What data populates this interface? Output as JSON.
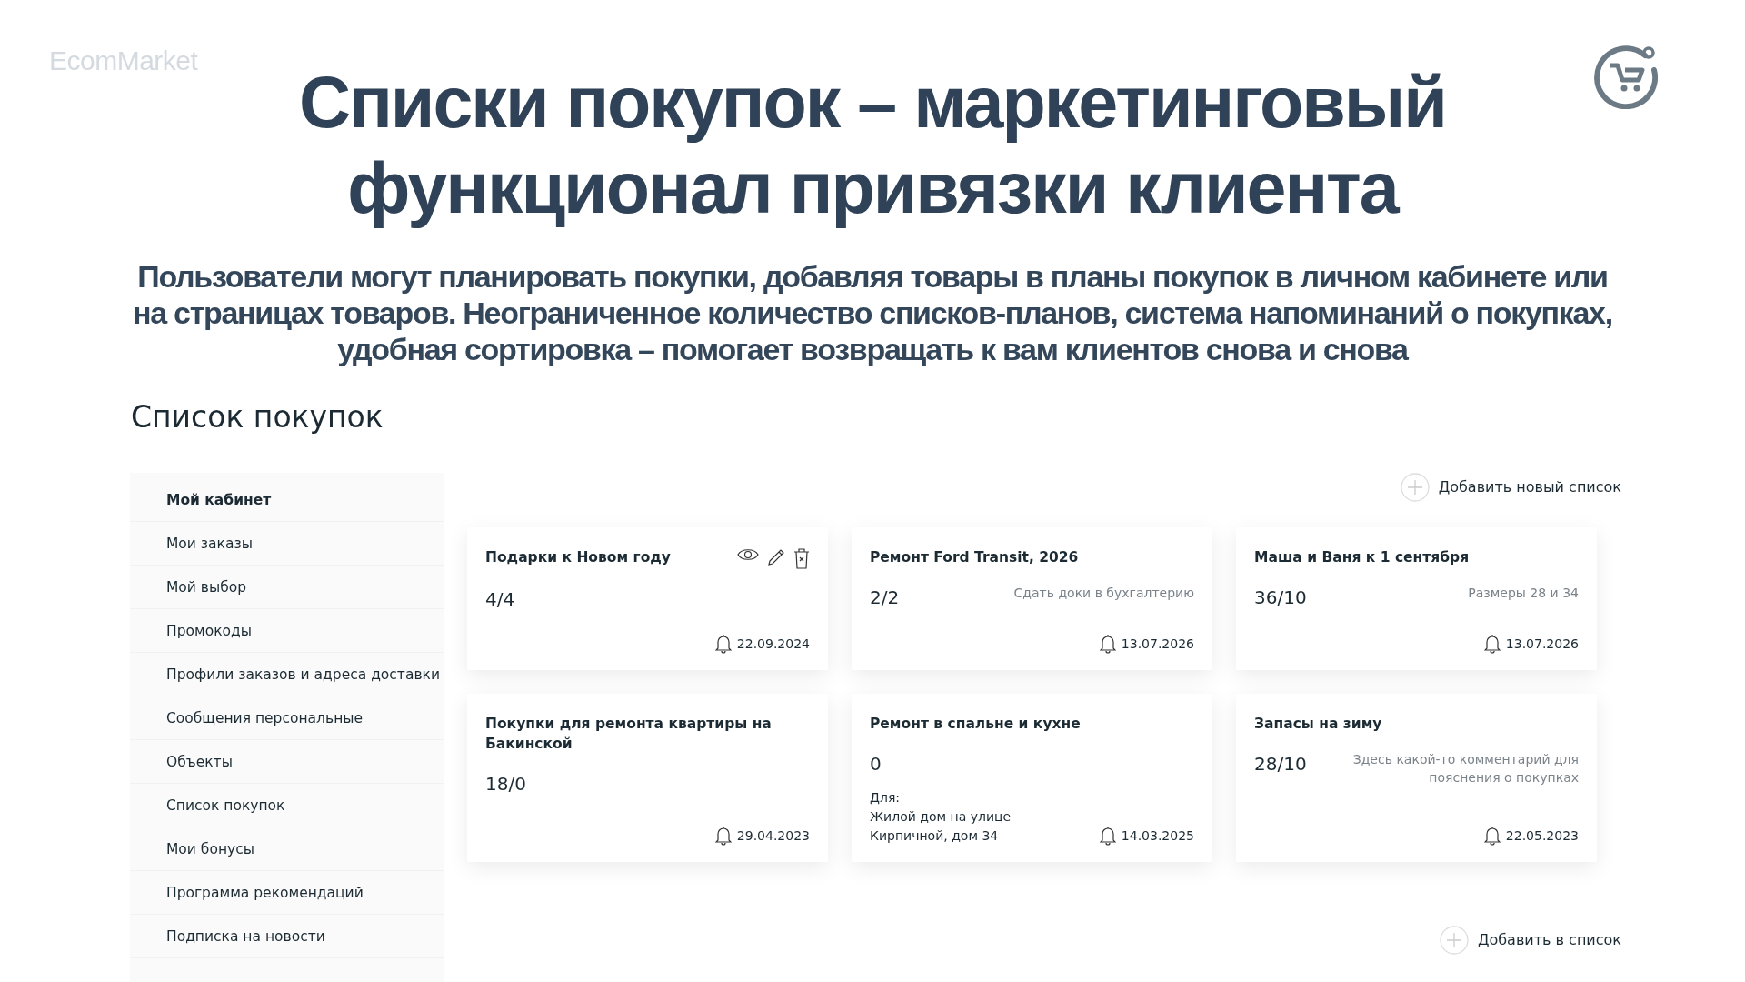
{
  "brand": {
    "name": "EcomMarket"
  },
  "title_lines": [
    "Списки покупок – маркетинговый",
    "функционал привязки клиента"
  ],
  "subtitle": "Пользователи могут планировать покупки, добавляя товары в планы покупок в личном кабинете или на страницах товаров.  Неограниченное количество списков-планов, система напоминаний о покупках, удобная сортировка – помогает возвращать к вам клиентов снова и снова",
  "page_heading": "Список покупок",
  "sidebar": {
    "items": [
      {
        "label": "Мой кабинет",
        "selected": true
      },
      {
        "label": "Мои заказы",
        "selected": false
      },
      {
        "label": "Мой выбор",
        "selected": false
      },
      {
        "label": "Промокоды",
        "selected": false
      },
      {
        "label": "Профили заказов и адреса доставки",
        "selected": false
      },
      {
        "label": "Сообщения персональные",
        "selected": false
      },
      {
        "label": "Объекты",
        "selected": false
      },
      {
        "label": "Список покупок",
        "selected": false
      },
      {
        "label": "Мои бонусы",
        "selected": false
      },
      {
        "label": "Программа рекомендаций",
        "selected": false
      },
      {
        "label": "Подписка на новости",
        "selected": false
      }
    ]
  },
  "add_list_button": "Добавить новый список",
  "lists": [
    {
      "title": "Подарки к Новом году",
      "count": "4/4",
      "date": "22.09.2024",
      "hovered": true
    },
    {
      "title": "Ремонт Ford Transit, 2026",
      "count": "2/2",
      "note": "Сдать доки в бухгалтерию",
      "date": "13.07.2026",
      "hovered": false
    },
    {
      "title": "Маша и Ваня к 1 сентября",
      "count": "36/10",
      "note": "Размеры 28 и 34",
      "date": "13.07.2026",
      "hovered": false
    },
    {
      "title": "Покупки для ремонта квартиры на Бакинской",
      "count": "18/0",
      "date": "29.04.2023",
      "hovered": false
    },
    {
      "title": "Ремонт в спальне и кухне",
      "count": "0",
      "for_label": "Для:",
      "for_text": "Жилой дом на улице Кирпичной, дом 34",
      "date": "14.03.2025",
      "hovered": false
    },
    {
      "title": "Запасы на зиму",
      "count": "28/10",
      "note": "Здесь какой-то комментарий для пояснения о покупках",
      "date": "22.05.2023",
      "hovered": false
    }
  ],
  "add_to_list_button": "Добавить в список"
}
